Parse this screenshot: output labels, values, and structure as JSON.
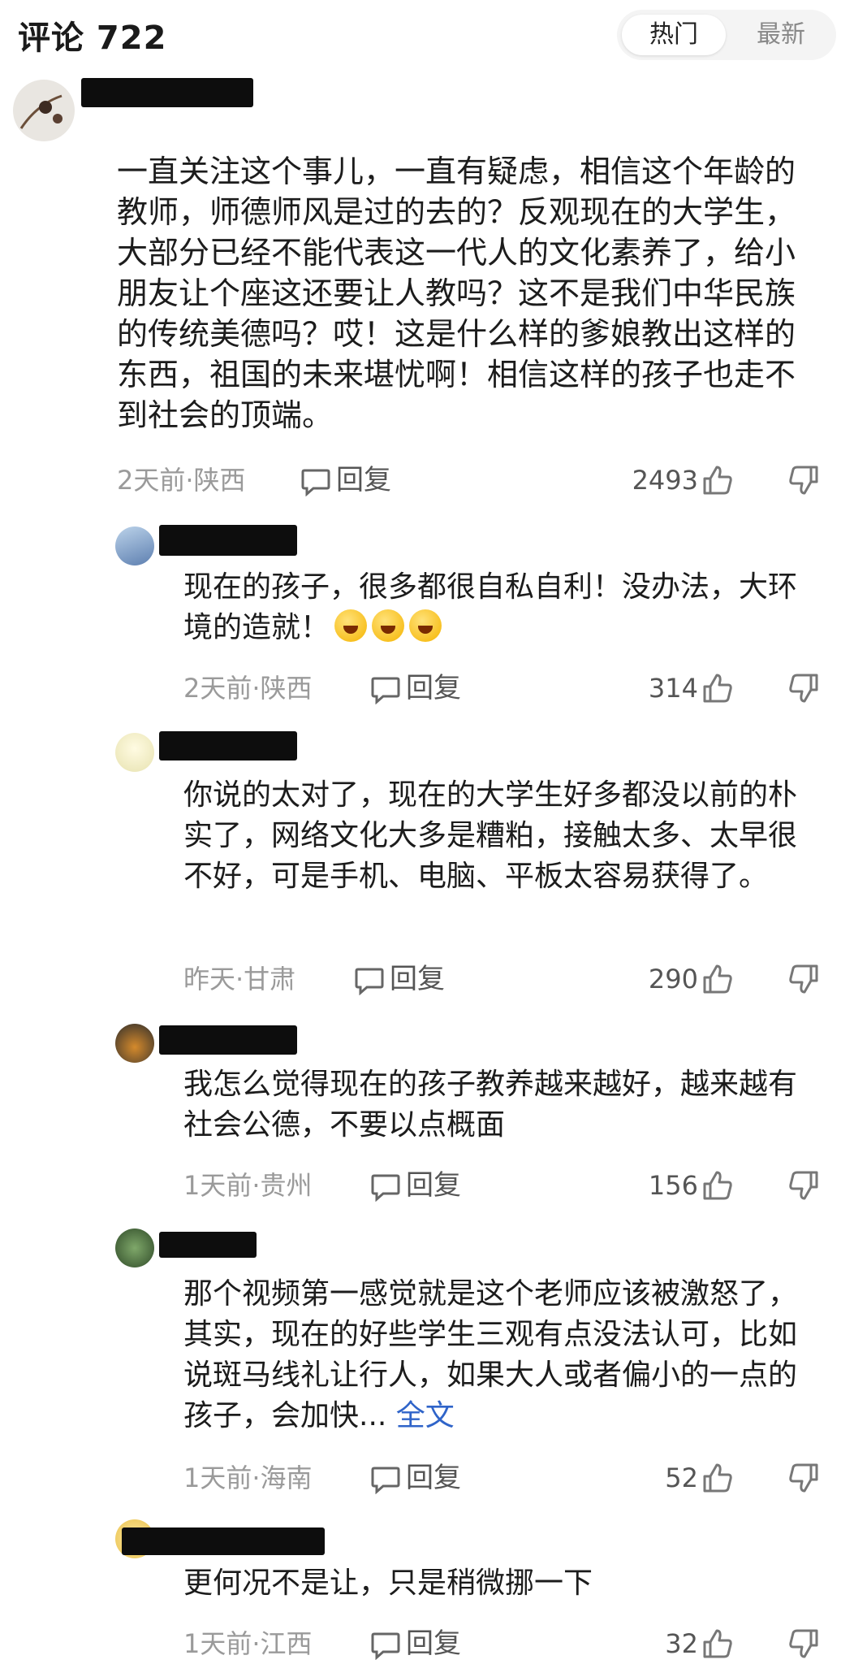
{
  "header": {
    "title": "评论 722",
    "sort_hot": "热门",
    "sort_new": "最新"
  },
  "comments": [
    {
      "text": "一直关注这个事儿，一直有疑虑，相信这个年龄的教师，师德师风是过的去的？反观现在的大学生，大部分已经不能代表这一代人的文化素养了，给小朋友让个座这还要让人教吗？这不是我们中华民族的传统美德吗？哎！这是什么样的爹娘教出这样的东西，祖国的未来堪忧啊！相信这样的孩子也走不到社会的顶端。",
      "meta": "2天前·陕西",
      "reply_label": "回复",
      "likes": "2493"
    },
    {
      "text": "现在的孩子，很多都很自私自利！没办法，大环境的造就！",
      "emoji": [
        "crying-laughing-emoji",
        "crying-laughing-emoji",
        "crying-laughing-emoji"
      ],
      "meta": "2天前·陕西",
      "reply_label": "回复",
      "likes": "314"
    },
    {
      "text": "你说的太对了，现在的大学生好多都没以前的朴实了，网络文化大多是糟粕，接触太多、太早很不好，可是手机、电脑、平板太容易获得了。",
      "meta": "昨天·甘肃",
      "reply_label": "回复",
      "likes": "290"
    },
    {
      "text": "我怎么觉得现在的孩子教养越来越好，越来越有社会公德，不要以点概面",
      "meta": "1天前·贵州",
      "reply_label": "回复",
      "likes": "156"
    },
    {
      "text": "那个视频第一感觉就是这个老师应该被激怒了，其实，现在的好些学生三观有点没法认可，比如说斑马线礼让行人，如果大人或者偏小的一点的孩子，会加快...",
      "fulltext_label": "全文",
      "meta": "1天前·海南",
      "reply_label": "回复",
      "likes": "52"
    },
    {
      "text": "更何况不是让，只是稍微挪一下",
      "meta": "1天前·江西",
      "reply_label": "回复",
      "likes": "32"
    }
  ],
  "icons": {
    "reply": "speech-bubble-icon",
    "like": "thumbs-up-icon",
    "dislike": "thumbs-down-icon"
  }
}
